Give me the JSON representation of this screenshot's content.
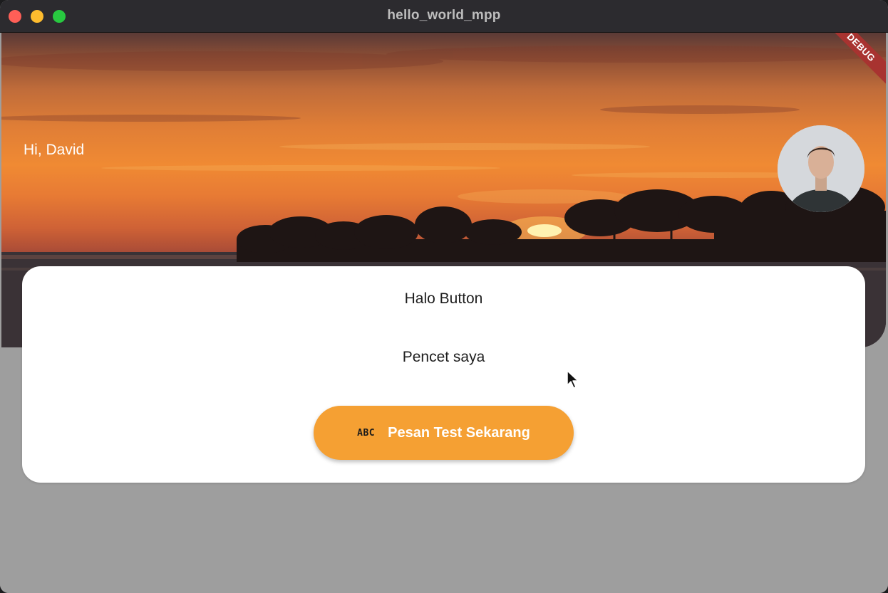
{
  "window": {
    "title": "hello_world_mpp"
  },
  "header": {
    "greeting": "Hi, David",
    "debug_banner": "DEBUG",
    "avatar_icon": "person-avatar"
  },
  "card": {
    "text_1": "Halo Button",
    "text_2": "Pencet saya",
    "button": {
      "icon_text": "ABC",
      "icon": "abc-icon",
      "label": "Pesan Test Sekarang"
    }
  },
  "colors": {
    "button_bg": "#f5a033",
    "debug_banner": "#a83330",
    "page_bg": "#9e9e9e"
  }
}
